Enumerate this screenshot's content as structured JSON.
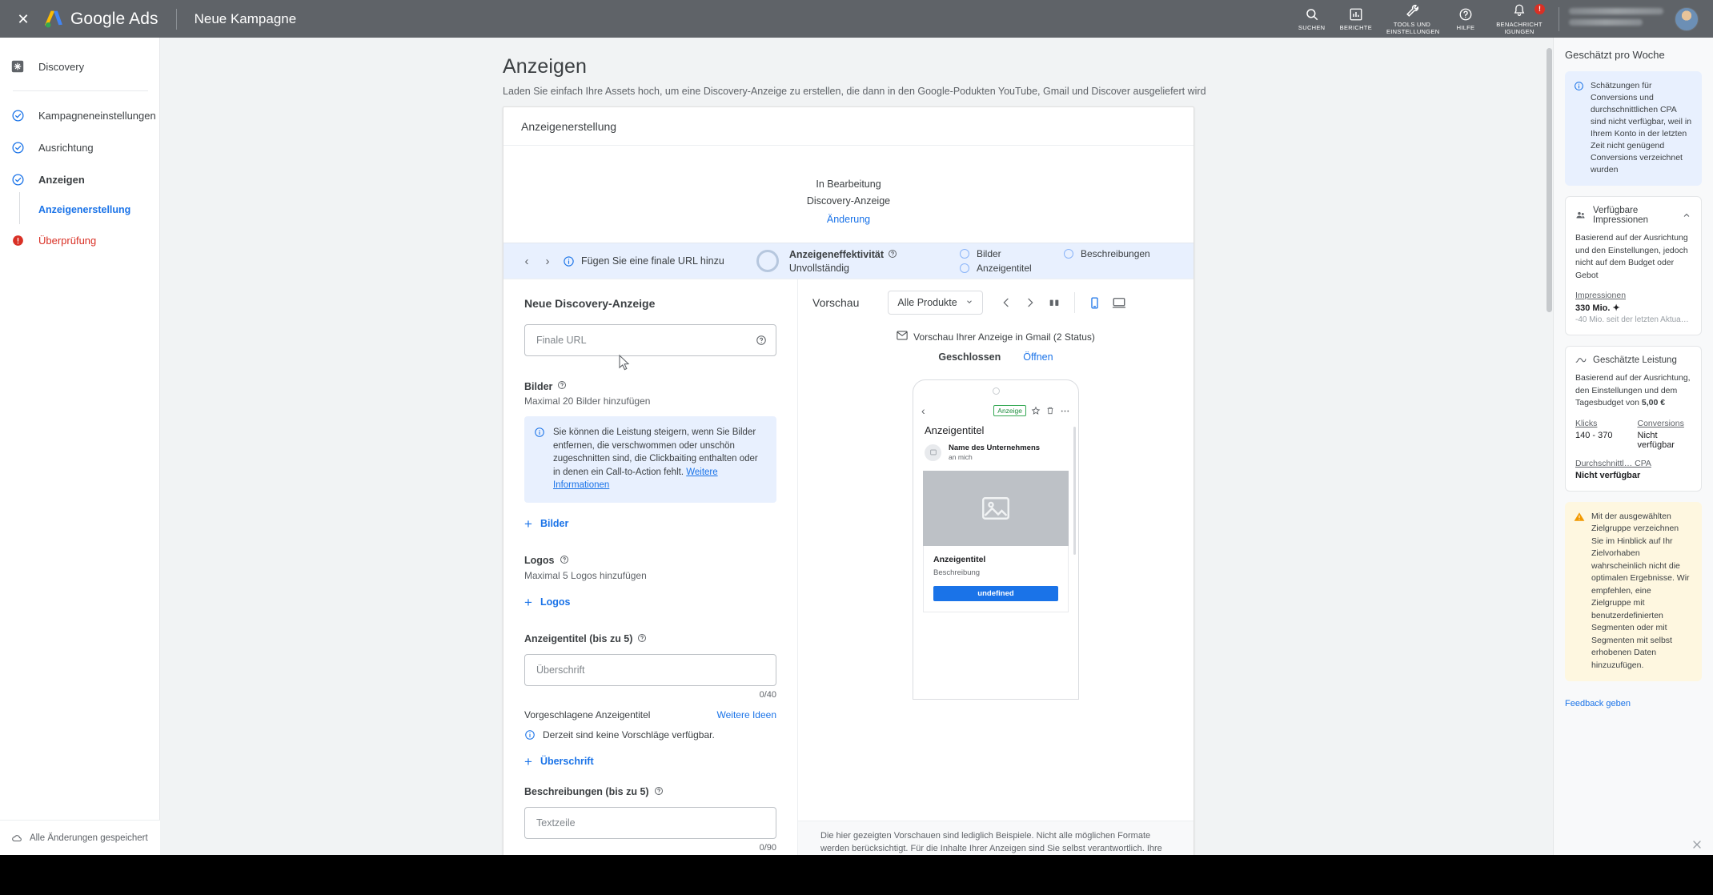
{
  "topbar": {
    "close_label": "✕",
    "brand": "Google Ads",
    "page_name": "Neue Kampagne",
    "actions": [
      {
        "name": "search",
        "label": "SUCHEN"
      },
      {
        "name": "reports",
        "label": "BERICHTE"
      },
      {
        "name": "tools",
        "label": "TOOLS UND EINSTELLUNGEN"
      },
      {
        "name": "help",
        "label": "HILFE"
      },
      {
        "name": "notifications",
        "label": "BENACHRICHT IGUNGEN",
        "badge": "!"
      }
    ]
  },
  "sidebar": {
    "items": [
      {
        "label": "Discovery",
        "icon": "discovery-icon",
        "state": "plain"
      },
      {
        "label": "Kampagneneinstellungen",
        "icon": "check-circle-icon",
        "state": "done"
      },
      {
        "label": "Ausrichtung",
        "icon": "check-circle-icon",
        "state": "done"
      },
      {
        "label": "Anzeigen",
        "icon": "check-circle-icon",
        "state": "current"
      },
      {
        "label": "Überprüfung",
        "icon": "error-circle-icon",
        "state": "error"
      }
    ],
    "sub_item": "Anzeigenerstellung",
    "saved_status": "Alle Änderungen gespeichert"
  },
  "main": {
    "title": "Anzeigen",
    "subtitle": "Laden Sie einfach Ihre Assets hoch, um eine Discovery-Anzeige zu erstellen, die dann in den Google-Podukten YouTube, Gmail und Discover ausgeliefert wird",
    "card_title": "Anzeigenerstellung",
    "in_progress": {
      "line1": "In Bearbeitung",
      "line2": "Discovery-Anzeige",
      "link": "Änderung"
    },
    "effectiveness": {
      "message": "Fügen Sie eine finale URL hinzu",
      "label": "Anzeigeneffektivität",
      "state": "Unvollständig",
      "checks": [
        "Bilder",
        "Beschreibungen",
        "Anzeigentitel"
      ]
    }
  },
  "form": {
    "heading": "Neue Discovery-Anzeige",
    "final_url_placeholder": "Finale URL",
    "images": {
      "label": "Bilder",
      "hint": "Maximal 20 Bilder hinzufügen",
      "info_text": "Sie können die Leistung steigern, wenn Sie Bilder entfernen, die verschwommen oder unschön zugeschnitten sind, die Clickbaiting enthalten oder in denen ein Call-to-Action fehlt.",
      "info_link": "Weitere Informationen",
      "add_label": "Bilder"
    },
    "logos": {
      "label": "Logos",
      "hint": "Maximal 5 Logos hinzufügen",
      "add_label": "Logos"
    },
    "headlines": {
      "label": "Anzeigentitel (bis zu 5)",
      "placeholder": "Überschrift",
      "counter": "0/40",
      "suggest_label": "Vorgeschlagene Anzeigentitel",
      "more_ideas": "Weitere Ideen",
      "no_suggestions": "Derzeit sind keine Vorschläge verfügbar.",
      "add_label": "Überschrift"
    },
    "descriptions": {
      "label": "Beschreibungen (bis zu 5)",
      "placeholder": "Textzeile",
      "counter": "0/90"
    }
  },
  "preview": {
    "title": "Vorschau",
    "product_filter": "Alle Produkte",
    "caption": "Vorschau Ihrer Anzeige in Gmail (2 Status)",
    "tabs": [
      {
        "label": "Geschlossen",
        "active": true
      },
      {
        "label": "Öffnen",
        "active": false
      }
    ],
    "phone": {
      "ad_chip": "Anzeige",
      "subject": "Anzeigentitel",
      "sender_name": "Name des Unternehmens",
      "sender_to": "an mich",
      "ad_headline": "Anzeigentitel",
      "ad_description": "Beschreibung",
      "cta": "undefined"
    },
    "disclaimer": "Die hier gezeigten Vorschauen sind lediglich Beispiele. Nicht alle möglichen Formate werden berücksichtigt. Für die Inhalte Ihrer Anzeigen sind Sie selbst verantwortlich. Ihre Assets dürfen"
  },
  "estimates": {
    "title": "Geschätzt pro Woche",
    "note": "Schätzungen für Conversions und durchschnittlichen CPA sind nicht verfügbar, weil in Ihrem Konto in der letzten Zeit nicht genügend Conversions verzeichnet wurden",
    "impressions_card": {
      "heading": "Verfügbare Impressionen",
      "desc": "Basierend auf der Ausrichtung und den Einstellungen, jedoch nicht auf dem Budget oder Gebot",
      "metric_label": "Impressionen",
      "metric_value": "330 Mio. ✦",
      "metric_sub": "-40 Mio. seit der letzten Aktua…"
    },
    "performance_card": {
      "heading": "Geschätzte Leistung",
      "desc_prefix": "Basierend auf der Ausrichtung, den Einstellungen und dem Tagesbudget von ",
      "budget": "5,00 €",
      "metrics": [
        {
          "label": "Klicks",
          "value": "140 - 370"
        },
        {
          "label": "Conversions",
          "value": "Nicht verfügbar"
        },
        {
          "label": "Durchschnittl… CPA",
          "value": "Nicht verfügbar"
        }
      ]
    },
    "warning": "Mit der ausgewählten Zielgruppe verzeichnen Sie im Hinblick auf Ihr Zielvorhaben wahrscheinlich nicht die optimalen Ergebnisse. Wir empfehlen, eine Zielgruppe mit benutzerdefinierten Segmenten oder mit Segmenten mit selbst erhobenen Daten hinzuzufügen.",
    "feedback": "Feedback geben"
  }
}
